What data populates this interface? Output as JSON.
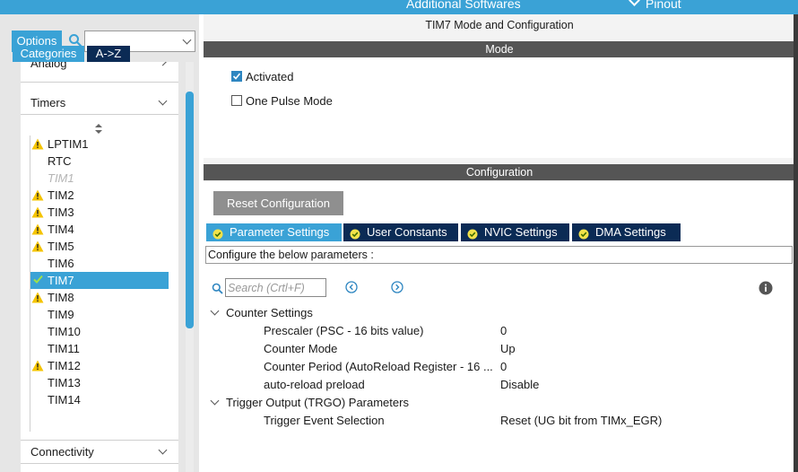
{
  "topbar": {
    "software_label": "Additional Softwares",
    "pinout_label": "Pinout"
  },
  "sidebar": {
    "options_label": "Options",
    "search": {
      "value": "",
      "placeholder": ""
    },
    "tabs": [
      {
        "label": "Categories",
        "active": true
      },
      {
        "label": "A->Z",
        "active": false
      }
    ],
    "categories": {
      "analog": "Analog",
      "timers": "Timers",
      "connectivity": "Connectivity"
    },
    "timers": [
      {
        "label": "LPTIM1",
        "status": "warning"
      },
      {
        "label": "RTC",
        "status": "none"
      },
      {
        "label": "TIM1",
        "status": "disabled"
      },
      {
        "label": "TIM2",
        "status": "warning"
      },
      {
        "label": "TIM3",
        "status": "warning"
      },
      {
        "label": "TIM4",
        "status": "warning"
      },
      {
        "label": "TIM5",
        "status": "warning"
      },
      {
        "label": "TIM6",
        "status": "none"
      },
      {
        "label": "TIM7",
        "status": "ok",
        "selected": true
      },
      {
        "label": "TIM8",
        "status": "warning"
      },
      {
        "label": "TIM9",
        "status": "none"
      },
      {
        "label": "TIM10",
        "status": "none"
      },
      {
        "label": "TIM11",
        "status": "none"
      },
      {
        "label": "TIM12",
        "status": "warning"
      },
      {
        "label": "TIM13",
        "status": "none"
      },
      {
        "label": "TIM14",
        "status": "none"
      }
    ]
  },
  "main": {
    "title": "TIM7 Mode and Configuration",
    "mode_header": "Mode",
    "mode_options": [
      {
        "label": "Activated",
        "checked": true
      },
      {
        "label": "One Pulse Mode",
        "checked": false
      }
    ],
    "config_header": "Configuration",
    "reset_label": "Reset Configuration",
    "tabs": [
      {
        "label": "Parameter Settings",
        "active": true
      },
      {
        "label": "User Constants",
        "active": false
      },
      {
        "label": "NVIC Settings",
        "active": false
      },
      {
        "label": "DMA Settings",
        "active": false
      }
    ],
    "description": "Configure the below parameters :",
    "param_search_placeholder": "Search (Crtl+F)",
    "groups": [
      {
        "label": "Counter Settings",
        "params": [
          {
            "name": "Prescaler (PSC - 16 bits value)",
            "value": "0"
          },
          {
            "name": "Counter Mode",
            "value": "Up"
          },
          {
            "name": "Counter Period (AutoReload Register - 16 ...",
            "value": "0"
          },
          {
            "name": "auto-reload preload",
            "value": "Disable"
          }
        ]
      },
      {
        "label": "Trigger Output (TRGO) Parameters",
        "params": [
          {
            "name": "Trigger Event Selection",
            "value": "Reset (UG bit from TIMx_EGR)"
          }
        ]
      }
    ]
  },
  "colors": {
    "accent": "#3aa2d6",
    "dark_tab": "#0b2b55",
    "section_bar": "#555555",
    "warning": "#f5c400",
    "button_gray": "#8f8f8f"
  }
}
